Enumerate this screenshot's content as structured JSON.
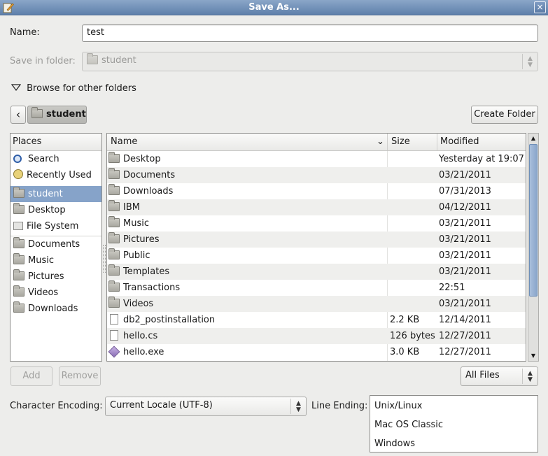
{
  "window": {
    "title": "Save As...",
    "close_glyph": "×",
    "app_icon": "edit-icon"
  },
  "name_field": {
    "label": "Name:",
    "value": "test"
  },
  "save_in": {
    "label": "Save in folder:",
    "value": "student"
  },
  "browse": {
    "label": "Browse for other folders"
  },
  "path_bar": {
    "back_glyph": "‹",
    "current": "student"
  },
  "create_folder": {
    "label": "Create Folder"
  },
  "places": {
    "header": "Places",
    "items": [
      {
        "label": "Search",
        "icon": "search-icon"
      },
      {
        "label": "Recently Used",
        "icon": "recent-icon"
      },
      {
        "label": "student",
        "icon": "home-folder-icon",
        "selected": true
      },
      {
        "label": "Desktop",
        "icon": "desktop-folder-icon"
      },
      {
        "label": "File System",
        "icon": "filesystem-icon"
      }
    ],
    "bookmarks": [
      {
        "label": "Documents",
        "icon": "folder-icon"
      },
      {
        "label": "Music",
        "icon": "folder-icon"
      },
      {
        "label": "Pictures",
        "icon": "folder-icon"
      },
      {
        "label": "Videos",
        "icon": "folder-icon"
      },
      {
        "label": "Downloads",
        "icon": "folder-icon"
      }
    ]
  },
  "files": {
    "columns": {
      "name": "Name",
      "size": "Size",
      "modified": "Modified"
    },
    "sort_glyph": "⌄",
    "rows": [
      {
        "name": "Desktop",
        "size": "",
        "modified": "Yesterday at 19:07",
        "type": "folder"
      },
      {
        "name": "Documents",
        "size": "",
        "modified": "03/21/2011",
        "type": "folder"
      },
      {
        "name": "Downloads",
        "size": "",
        "modified": "07/31/2013",
        "type": "folder"
      },
      {
        "name": "IBM",
        "size": "",
        "modified": "04/12/2011",
        "type": "folder"
      },
      {
        "name": "Music",
        "size": "",
        "modified": "03/21/2011",
        "type": "folder"
      },
      {
        "name": "Pictures",
        "size": "",
        "modified": "03/21/2011",
        "type": "folder"
      },
      {
        "name": "Public",
        "size": "",
        "modified": "03/21/2011",
        "type": "folder"
      },
      {
        "name": "Templates",
        "size": "",
        "modified": "03/21/2011",
        "type": "folder"
      },
      {
        "name": "Transactions",
        "size": "",
        "modified": "22:51",
        "type": "folder"
      },
      {
        "name": "Videos",
        "size": "",
        "modified": "03/21/2011",
        "type": "folder"
      },
      {
        "name": "db2_postinstallation",
        "size": "2.2 KB",
        "modified": "12/14/2011",
        "type": "file"
      },
      {
        "name": "hello.cs",
        "size": "126 bytes",
        "modified": "12/27/2011",
        "type": "file"
      },
      {
        "name": "hello.exe",
        "size": "3.0 KB",
        "modified": "12/27/2011",
        "type": "exe"
      }
    ]
  },
  "buttons": {
    "add": "Add",
    "remove": "Remove"
  },
  "filter": {
    "value": "All Files"
  },
  "encoding": {
    "label": "Character Encoding:",
    "value": "Current Locale (UTF-8)"
  },
  "line_ending": {
    "label": "Line Ending:",
    "options": [
      "Unix/Linux",
      "Mac OS Classic",
      "Windows"
    ]
  },
  "colors": {
    "titlebar": "#6f8fb8",
    "selection": "#86a3c9"
  }
}
